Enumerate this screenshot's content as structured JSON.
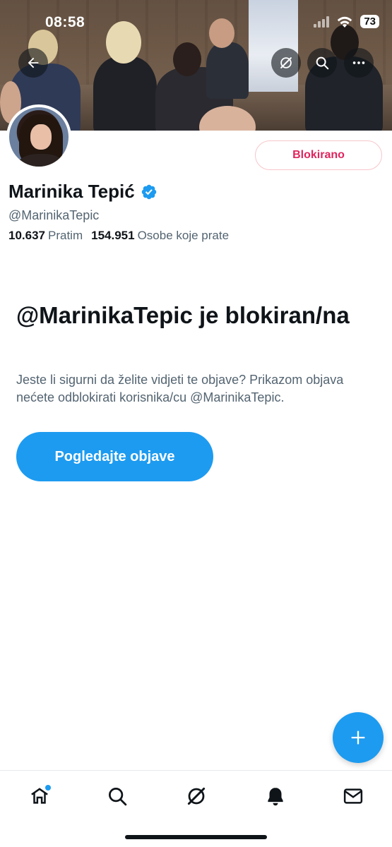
{
  "status_bar": {
    "time": "08:58",
    "battery": "73"
  },
  "header": {
    "icons": [
      "back-arrow-icon",
      "grok-icon",
      "search-icon",
      "more-icon"
    ]
  },
  "profile": {
    "display_name": "Marinika Tepić",
    "handle": "@MarinikaTepic",
    "verified": true,
    "following_count": "10.637",
    "following_label": "Pratim",
    "followers_count": "154.951",
    "followers_label": "Osobe koje prate",
    "blocked_button_label": "Blokirano"
  },
  "blocked_notice": {
    "title": "@MarinikaTepic je blokiran/na",
    "description": "Jeste li sigurni da želite vidjeti te objave? Prikazom objava nećete odblokirati korisnika/cu @MarinikaTepic.",
    "view_posts_label": "Pogledajte objave"
  },
  "fab": {
    "icon": "plus-icon"
  },
  "bottom_nav": {
    "items": [
      {
        "name": "home",
        "icon": "home-icon",
        "has_dot": true
      },
      {
        "name": "search",
        "icon": "search-icon"
      },
      {
        "name": "grok",
        "icon": "grok-icon"
      },
      {
        "name": "notifications",
        "icon": "bell-icon"
      },
      {
        "name": "messages",
        "icon": "mail-icon"
      }
    ]
  },
  "colors": {
    "accent": "#1d9bf0",
    "blocked_red": "#e0245e",
    "text_primary": "#0f1419",
    "text_secondary": "#536471"
  }
}
